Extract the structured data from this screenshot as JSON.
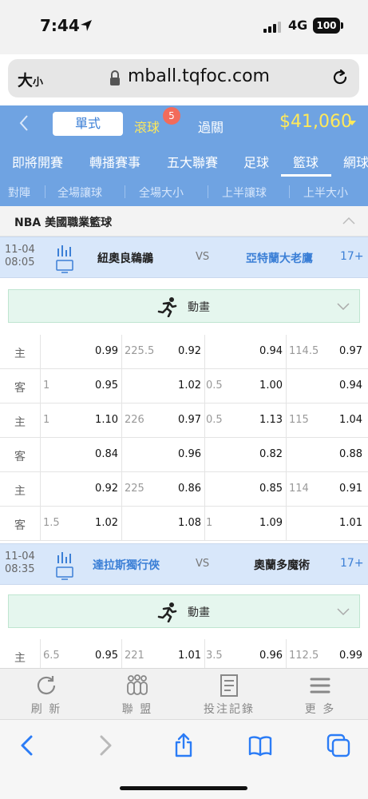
{
  "status_bar": {
    "time": "7:44",
    "network": "4G",
    "battery": "100"
  },
  "browser": {
    "text_size_label": "大",
    "text_size_small": "小",
    "url": "mball.tqfoc.com"
  },
  "top_nav": {
    "single_label": "單式",
    "live_label": "滾球",
    "live_count": "5",
    "parlay_label": "過關",
    "balance": "$41,060"
  },
  "sport_tabs": [
    "即將開賽",
    "轉播賽事",
    "五大聯賽",
    "足球",
    "籃球",
    "網球"
  ],
  "active_sport": "籃球",
  "bet_type_tabs": [
    "對陣",
    "全場讓球",
    "全場大小",
    "上半讓球",
    "上半大小"
  ],
  "league": {
    "title": "NBA 美國職業籃球"
  },
  "matches": [
    {
      "date": "11-04",
      "time": "08:05",
      "team1": "紐奧良鵜鶘",
      "vs": "VS",
      "team2": "亞特蘭大老鷹",
      "more": "17+",
      "animation_label": "動畫",
      "rows": [
        {
          "label": "主",
          "h1": "",
          "o1": "0.99",
          "h2": "225.5",
          "o2": "0.92",
          "h3": "",
          "o3": "0.94",
          "h4": "114.5",
          "o4": "0.97"
        },
        {
          "label": "客",
          "h1": "1",
          "o1": "0.95",
          "h2": "",
          "o2": "1.02",
          "h3": "0.5",
          "o3": "1.00",
          "h4": "",
          "o4": "0.94"
        },
        {
          "label": "主",
          "h1": "1",
          "o1": "1.10",
          "h2": "226",
          "o2": "0.97",
          "h3": "0.5",
          "o3": "1.13",
          "h4": "115",
          "o4": "1.04"
        },
        {
          "label": "客",
          "h1": "",
          "o1": "0.84",
          "h2": "",
          "o2": "0.96",
          "h3": "",
          "o3": "0.82",
          "h4": "",
          "o4": "0.88"
        },
        {
          "label": "主",
          "h1": "",
          "o1": "0.92",
          "h2": "225",
          "o2": "0.86",
          "h3": "",
          "o3": "0.85",
          "h4": "114",
          "o4": "0.91"
        },
        {
          "label": "客",
          "h1": "1.5",
          "o1": "1.02",
          "h2": "",
          "o2": "1.08",
          "h3": "1",
          "o3": "1.09",
          "h4": "",
          "o4": "1.01"
        }
      ]
    },
    {
      "date": "11-04",
      "time": "08:35",
      "team1": "達拉斯獨行俠",
      "vs": "VS",
      "team2": "奧蘭多魔術",
      "more": "17+",
      "animation_label": "動畫",
      "rows": [
        {
          "label": "主",
          "h1": "6.5",
          "o1": "0.95",
          "h2": "221",
          "o2": "1.01",
          "h3": "3.5",
          "o3": "0.96",
          "h4": "112.5",
          "o4": "0.99"
        }
      ]
    }
  ],
  "bottom_nav": {
    "refresh": "刷 新",
    "league": "聯 盟",
    "history": "投注記錄",
    "more": "更 多"
  },
  "colors": {
    "primary": "#6fa3e2",
    "accent_yellow": "#ffe95a",
    "link_blue": "#3b7fd6",
    "match_bg": "#d8e7fa"
  }
}
